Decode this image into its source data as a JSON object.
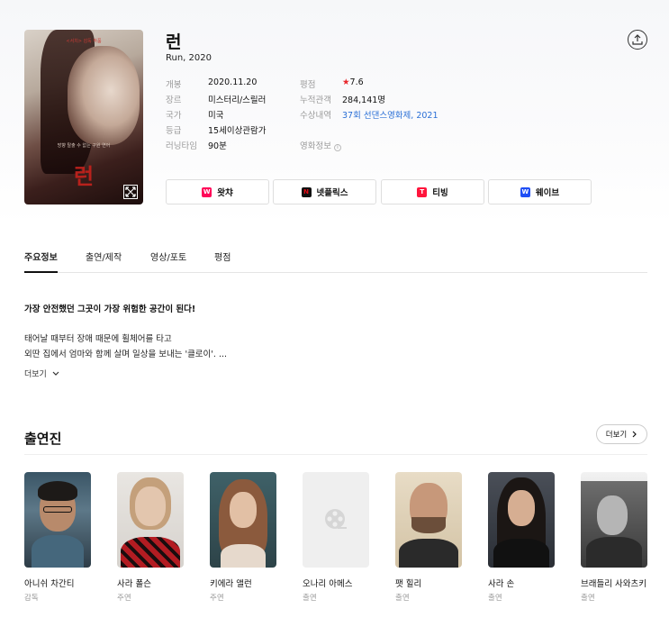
{
  "movie": {
    "title": "런",
    "subtitle": "Run, 2020",
    "poster": {
      "tagline": "<서치> 감독 작품",
      "title": "런",
      "line": "방향 탈출 수 없는 구원 연어"
    },
    "info_left": [
      {
        "label": "개봉",
        "value": "2020.11.20"
      },
      {
        "label": "장르",
        "value": "미스터리/스릴러"
      },
      {
        "label": "국가",
        "value": "미국"
      },
      {
        "label": "등급",
        "value": "15세이상관람가"
      },
      {
        "label": "러닝타임",
        "value": "90분"
      }
    ],
    "rating": {
      "label": "평점",
      "star": "★",
      "value": "7.6"
    },
    "audience": {
      "label": "누적관객",
      "value": "284,141명"
    },
    "awards": {
      "label": "수상내역",
      "value": "37회 선댄스영화제, 2021"
    },
    "movie_info": {
      "label": "영화정보",
      "icon": "i"
    },
    "ott": [
      {
        "label": "왓챠",
        "logo": "W",
        "color": "#ff0558"
      },
      {
        "label": "넷플릭스",
        "logo": "N",
        "color": "#111111"
      },
      {
        "label": "티빙",
        "logo": "T",
        "color": "#ff153c"
      },
      {
        "label": "웨이브",
        "logo": "W",
        "color": "#1f4ef5"
      }
    ]
  },
  "tabs": [
    "주요정보",
    "출연/제작",
    "영상/포토",
    "평점"
  ],
  "synopsis": {
    "headline": "가장 안전했던 그곳이 가장 위험한 공간이 된다!",
    "lines": [
      "태어날 때부터 장애 때문에 휠체어를 타고",
      "외딴 집에서 엄마와 함께 살며 일상을 보내는 '클로이'. ..."
    ],
    "more_label": "더보기"
  },
  "cast": {
    "title": "출연진",
    "more_label": "더보기",
    "members": [
      {
        "name": "아니쉬 차간티",
        "role": "감독"
      },
      {
        "name": "사라 폴슨",
        "role": "주연"
      },
      {
        "name": "키에라 앨런",
        "role": "주연"
      },
      {
        "name": "오나리 아메스",
        "role": "출연"
      },
      {
        "name": "팻 힐리",
        "role": "출연"
      },
      {
        "name": "사라 손",
        "role": "출연"
      },
      {
        "name": "브래들리 사와츠키",
        "role": "출연"
      }
    ]
  }
}
